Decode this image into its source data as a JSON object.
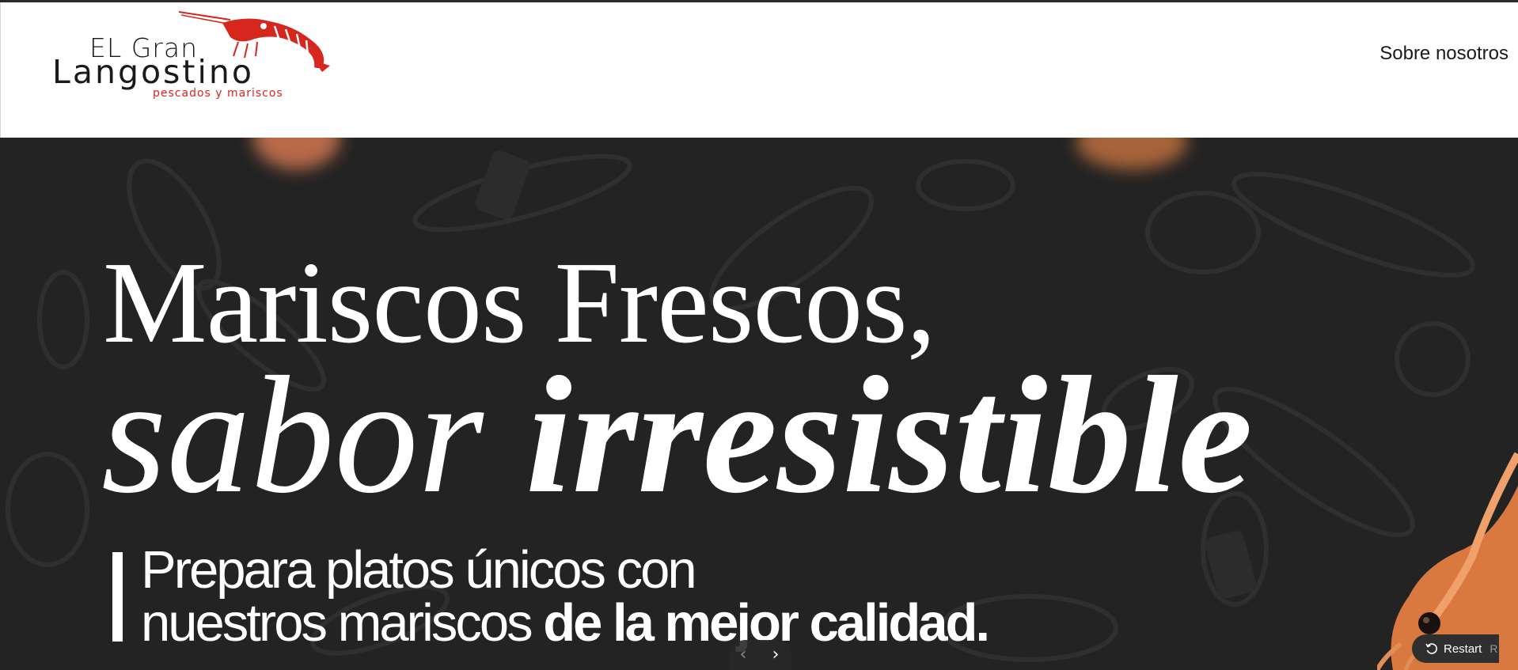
{
  "header": {
    "logo": {
      "line1": "EL Gran",
      "line2": "Langostino",
      "tagline": "pescados y mariscos",
      "accent_color": "#d6261d"
    },
    "nav": [
      {
        "label": "Sobre nosotros"
      }
    ]
  },
  "hero": {
    "headline_line1": "Mariscos Frescos,",
    "headline_line2_light": "sabor ",
    "headline_line2_bold": "irresistible",
    "subhead_line1": "Prepara platos únicos con",
    "subhead_line2_regular": "nuestros mariscos ",
    "subhead_line2_bold": "de la mejor calidad.",
    "background_color": "#232323",
    "slider": {
      "prev_icon": "chevron-left-icon",
      "next_icon": "chevron-right-icon"
    }
  },
  "restart_button": {
    "label": "Restart",
    "shortcut": "R",
    "icon": "restart-icon"
  }
}
